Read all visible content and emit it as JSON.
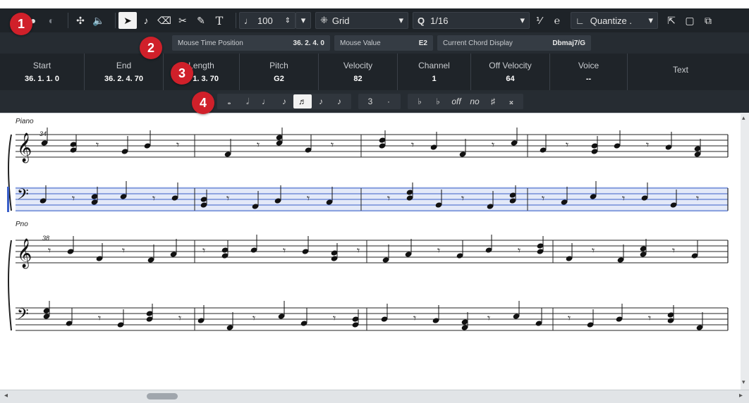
{
  "toolbar": {
    "velocity_value": "100",
    "grid_label": "Grid",
    "quantize_value": "1/16",
    "quantize_label": "Quantize ."
  },
  "infoline": {
    "mouse_time_label": "Mouse Time Position",
    "mouse_time_value": "36. 2. 4.    0",
    "mouse_value_label": "Mouse Value",
    "mouse_value_value": "E2",
    "chord_label": "Current Chord Display",
    "chord_value": "Dbmaj7/G"
  },
  "props": [
    {
      "label": "Start",
      "value": "36. 1. 1.    0"
    },
    {
      "label": "End",
      "value": "36. 2. 4. 70"
    },
    {
      "label": "Length",
      "value": "0. 1. 3. 70"
    },
    {
      "label": "Pitch",
      "value": "G2"
    },
    {
      "label": "Velocity",
      "value": "82"
    },
    {
      "label": "Channel",
      "value": "1"
    },
    {
      "label": "Off Velocity",
      "value": "64"
    },
    {
      "label": "Voice",
      "value": "--"
    },
    {
      "label": "Text",
      "value": ""
    }
  ],
  "notebar": {
    "tuplet_label": "3",
    "accidental_labels": [
      "off",
      "no"
    ]
  },
  "score": {
    "system1_label": "Piano",
    "system1_measure": "34",
    "system2_label": "Pno",
    "system2_measure": "38"
  },
  "badges": [
    "1",
    "2",
    "3",
    "4"
  ],
  "colors": {
    "accent": "#d0202a",
    "selected_staff": "#3a5fc9",
    "toolbar_bg": "#1e2328"
  }
}
